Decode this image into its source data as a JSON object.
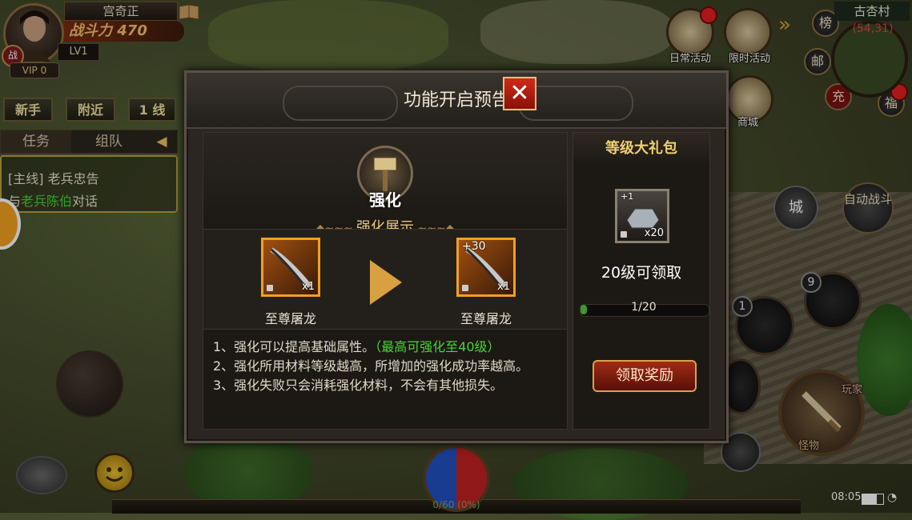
{
  "player": {
    "name": "宫奇正",
    "power_label": "战斗力",
    "power": "470",
    "level": "LV1",
    "vip": "VIP 0",
    "war_badge": "战"
  },
  "channel_buttons": [
    "新手",
    "附近",
    "1 线"
  ],
  "quest_panel": {
    "tabs": [
      "任务",
      "组队"
    ],
    "line1": "[主线] 老兵忠告",
    "line2_pre": "与",
    "line2_npc": "老兵陈伯",
    "line2_post": "对话"
  },
  "hud": {
    "daily_events": "日常活动",
    "limited_events": "限时活动",
    "shop": "商城",
    "rank": "榜",
    "mail": "邮",
    "recharge": "充",
    "welfare": "福",
    "map_name": "古杏村",
    "map_coords": "(54,31)",
    "city_btn": "城",
    "auto_battle": "自动战斗",
    "player_tag": "玩家",
    "monster_tag": "怪物",
    "skill_1": "1",
    "skill_9": "9"
  },
  "modal": {
    "title": "功能开启预告",
    "close": "✕",
    "feature_name": "强化",
    "showcase_title": "强化展示",
    "item_before": {
      "name": "至尊屠龙",
      "count": "x1",
      "plus": ""
    },
    "item_after": {
      "name": "至尊屠龙",
      "count": "x1",
      "plus": "+30"
    },
    "desc_1a": "1、强化可以提高基础属性。",
    "desc_1b": "（最高可强化至40级）",
    "desc_2": "2、强化所用材料等级越高，所增加的强化成功率越高。",
    "desc_3": "3、强化失败只会消耗强化材料，不会有其他损失。",
    "gift": {
      "title": "等级大礼包",
      "item_plus": "+1",
      "item_count": "x20",
      "level_text": "20级可领取",
      "progress_text": "1/20",
      "progress_value": 0.05,
      "claim_label": "领取奖励"
    }
  },
  "bottom": {
    "exp_text": "0/60 (0%)",
    "time": "08:05"
  },
  "colors": {
    "accent_gold": "#e8c880",
    "npc_green": "#4cd23a",
    "close_red": "#d02a18"
  },
  "icons": [
    "book-icon",
    "hammer-icon",
    "sword-icon",
    "ingot-icon",
    "chat-icon",
    "emoji-icon",
    "wifi-icon",
    "battery-icon"
  ]
}
